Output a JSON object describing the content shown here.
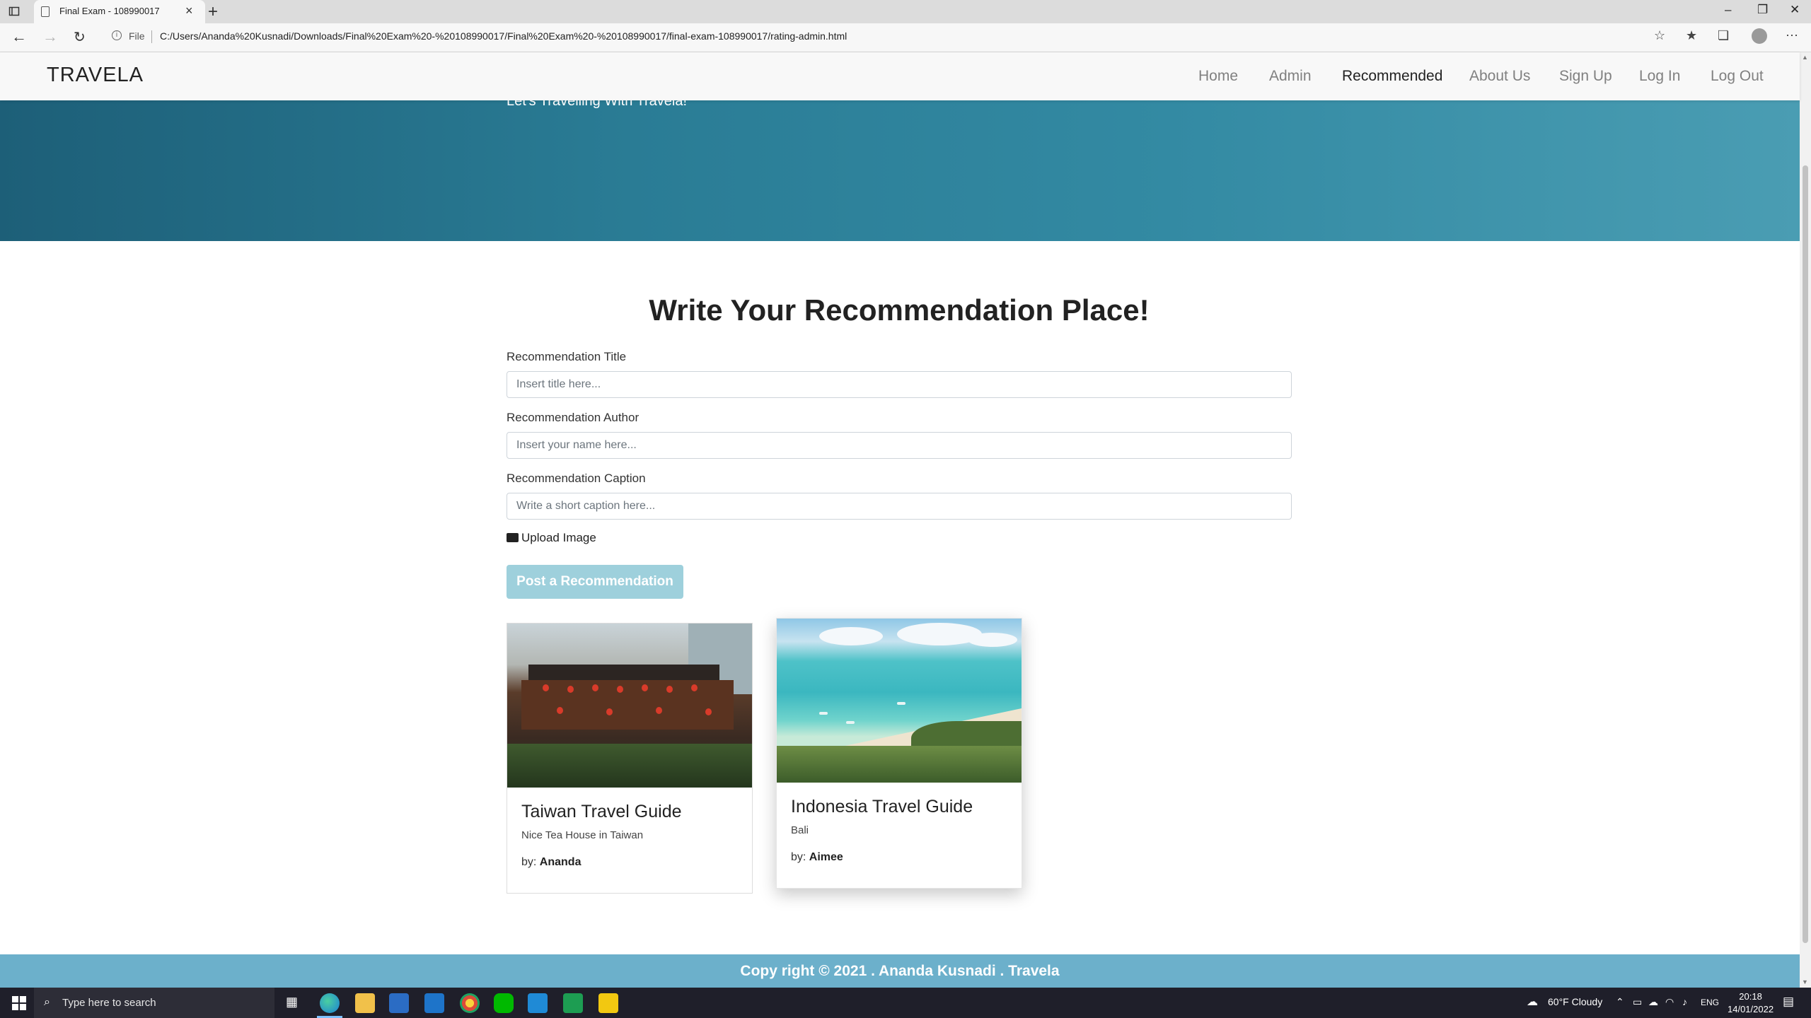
{
  "browser": {
    "tab_title": "Final Exam - 108990017",
    "file_label": "File",
    "url": "C:/Users/Ananda%20Kusnadi/Downloads/Final%20Exam%20-%20108990017/Final%20Exam%20-%20108990017/final-exam-108990017/rating-admin.html"
  },
  "nav": {
    "brand": "TRAVELA",
    "items": [
      {
        "label": "Home",
        "active": false
      },
      {
        "label": "Admin",
        "active": false
      },
      {
        "label": "Recommended",
        "active": true
      },
      {
        "label": "About Us",
        "active": false
      },
      {
        "label": "Sign Up",
        "active": false
      },
      {
        "label": "Log In",
        "active": false
      },
      {
        "label": "Log Out",
        "active": false
      }
    ]
  },
  "hero": {
    "tagline": "Let's Travelling With Travela!"
  },
  "form": {
    "heading": "Write Your Recommendation Place!",
    "title_label": "Recommendation Title",
    "title_placeholder": "Insert title here...",
    "author_label": "Recommendation Author",
    "author_placeholder": "Insert your name here...",
    "caption_label": "Recommendation Caption",
    "caption_placeholder": "Write a short caption here...",
    "upload_label": "Upload Image",
    "submit_label": "Post a Recommendation"
  },
  "cards": [
    {
      "title": "Taiwan Travel Guide",
      "caption": "Nice Tea House in Taiwan",
      "by_prefix": "by:",
      "author": "Ananda"
    },
    {
      "title": "Indonesia Travel Guide",
      "caption": "Bali",
      "by_prefix": "by:",
      "author": "Aimee"
    }
  ],
  "footer": {
    "text": "Copy right © 2021 . Ananda Kusnadi . Travela"
  },
  "taskbar": {
    "search_placeholder": "Type here to search",
    "weather": "60°F  Cloudy",
    "language": "ENG",
    "time": "20:18",
    "date": "14/01/2022"
  },
  "colors": {
    "hero": "#2a7c95",
    "button": "#9ed0dc",
    "footer": "#6cb0cb",
    "taskbar": "#1f1f2a"
  }
}
